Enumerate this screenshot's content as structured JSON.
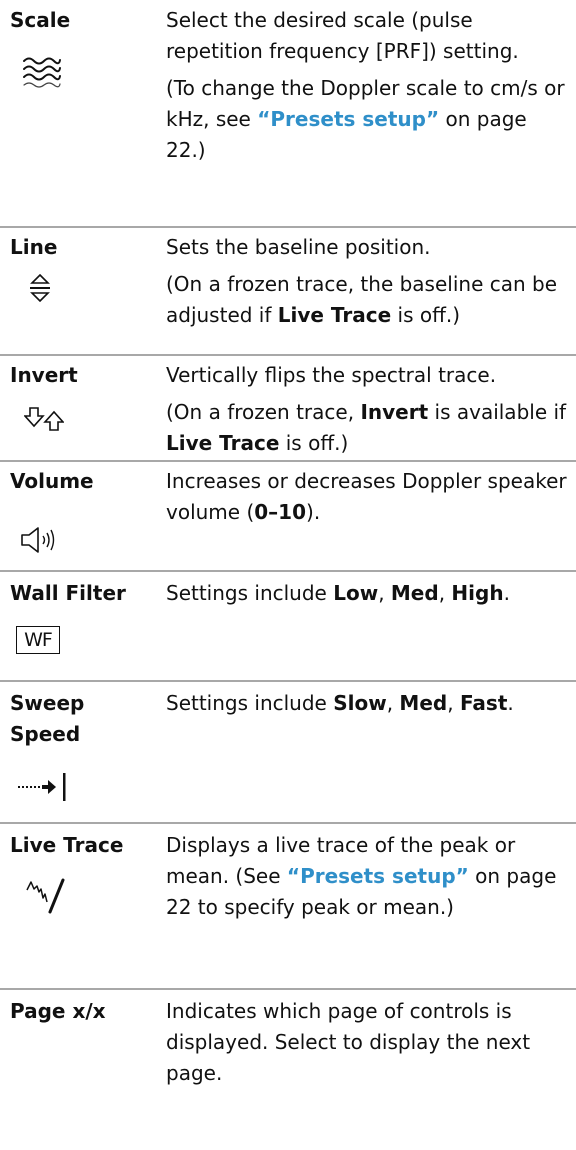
{
  "rows": [
    {
      "name": "Scale",
      "icon": "scale-wave-icon",
      "description": [
        "Select the desired scale (pulse repetition frequency [PRF]) setting.",
        "(To change the Doppler scale to cm/s or kHz, see “Presets setup” on page 22.)"
      ]
    },
    {
      "name": "Line",
      "icon": "baseline-arrows-icon",
      "description": [
        "Sets the baseline position.",
        "(On a frozen trace, the baseline can be adjusted if Live Trace is off.)"
      ]
    },
    {
      "name": "Invert",
      "icon": "invert-arrows-icon",
      "description": [
        "Vertically flips the spectral trace.",
        "(On a frozen trace, Invert is available if Live Trace is off.)"
      ]
    },
    {
      "name": "Volume",
      "icon": "speaker-volume-icon",
      "description": [
        "Increases or decreases Doppler speaker volume (0–10)."
      ]
    },
    {
      "name": "Wall Filter",
      "icon": "wall-filter-icon",
      "icon_text": "WF",
      "description": [
        "Settings include Low, Med, High."
      ]
    },
    {
      "name": "Sweep Speed",
      "icon": "sweep-speed-icon",
      "description": [
        "Settings include Slow, Med, Fast."
      ]
    },
    {
      "name": "Live Trace",
      "icon": "live-trace-icon",
      "description": [
        "Displays a live trace of the peak or mean. (See “Presets setup” on page 22 to specify peak or mean.)"
      ]
    },
    {
      "name": "Page x/x",
      "icon": "",
      "description": [
        "Indicates which page of controls is displayed. Select to display the next page."
      ]
    }
  ],
  "link_text": "Presets setup",
  "bold_terms": [
    "Live Trace",
    "Invert",
    "0–10",
    "Low",
    "Med",
    "High",
    "Slow",
    "Fast"
  ],
  "colors": {
    "link": "#2f8fc9",
    "text": "#111111",
    "separator": "#a8a8a8"
  }
}
